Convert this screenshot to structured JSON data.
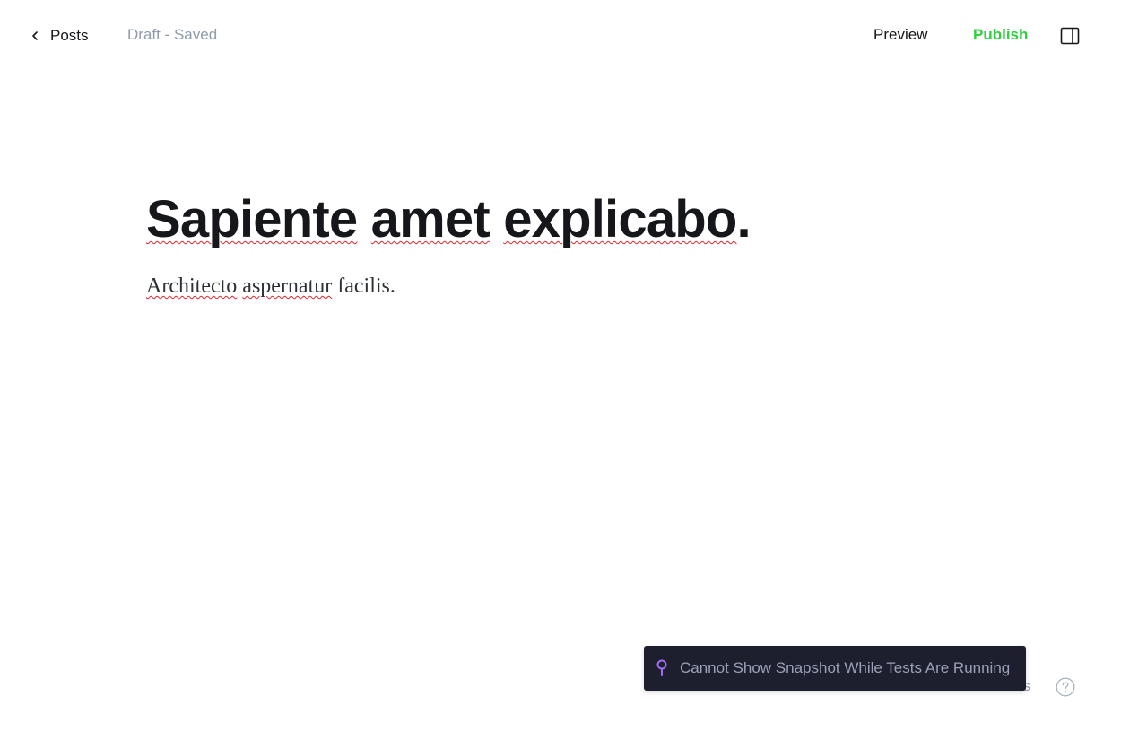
{
  "header": {
    "back_label": "Posts",
    "status": "Draft - Saved",
    "preview_label": "Preview",
    "publish_label": "Publish"
  },
  "post": {
    "title_words": [
      "Sapiente",
      "amet",
      "explicabo",
      "."
    ],
    "body_words": [
      "Architecto",
      "aspernatur",
      "facilis."
    ]
  },
  "footer": {
    "word_count": "6 words",
    "help_icon": "question-circle-icon"
  },
  "toast": {
    "message": "Cannot Show Snapshot While Tests Are Running",
    "icon": "pin-icon"
  },
  "colors": {
    "publish": "#30cf43",
    "muted": "#8e9cac",
    "toast_bg": "#1d1f2e",
    "pin": "#a26cf0",
    "spell_error": "#e0252b"
  }
}
